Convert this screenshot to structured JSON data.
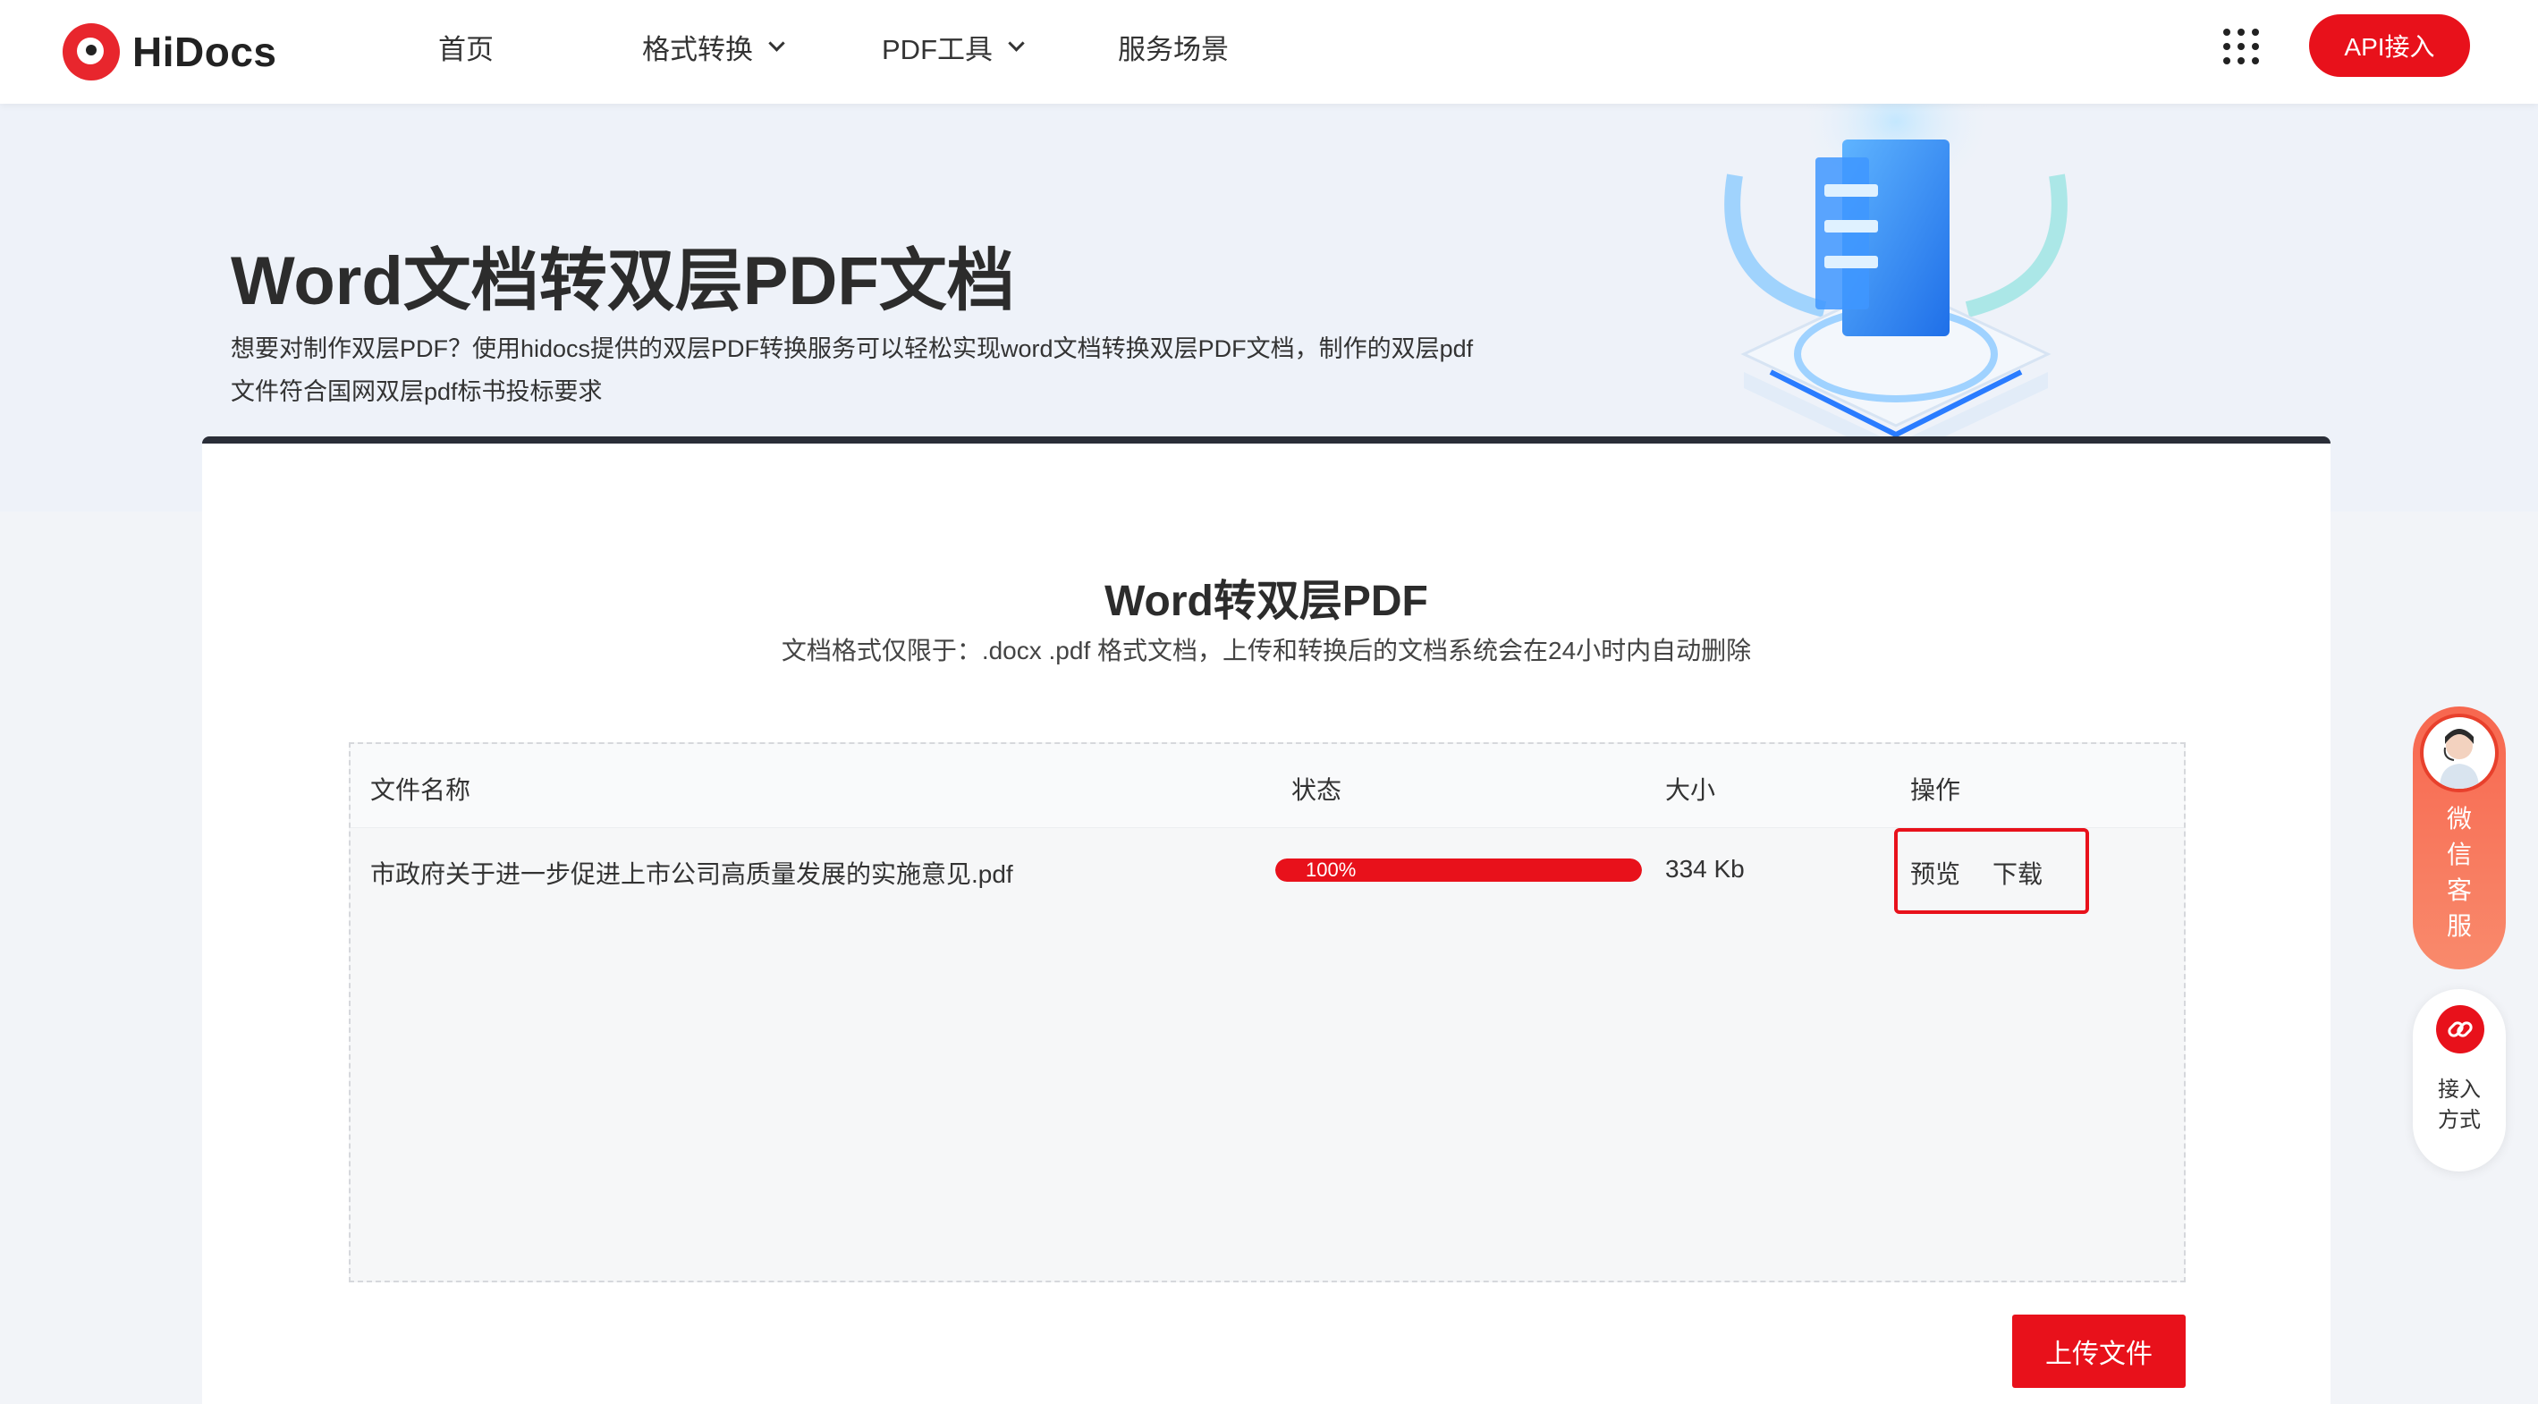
{
  "header": {
    "brand": "HiDocs",
    "nav": [
      {
        "label": "首页"
      },
      {
        "label": "格式转换"
      },
      {
        "label": "PDF工具"
      },
      {
        "label": "服务场景"
      }
    ],
    "api_button": "API接入",
    "apps_icon": "apps-grid-icon"
  },
  "hero": {
    "title": "Word文档转双层PDF文档",
    "description": "想要对制作双层PDF？使用hidocs提供的双层PDF转换服务可以轻松实现word文档转换双层PDF文档，制作的双层pdf文件符合国网双层pdf标书投标要求"
  },
  "converter": {
    "title": "Word转双层PDF",
    "subtitle": "文档格式仅限于：.docx .pdf 格式文档，上传和转换后的文档系统会在24小时内自动删除",
    "columns": {
      "name": "文件名称",
      "status": "状态",
      "size": "大小",
      "actions": "操作"
    },
    "rows": [
      {
        "name": "市政府关于进一步促进上市公司高质量发展的实施意见.pdf",
        "progress_label": "100%",
        "progress": 1.0,
        "size": "334 Kb",
        "preview": "预览",
        "download": "下载"
      }
    ],
    "upload_button": "上传文件"
  },
  "float": {
    "wechat": [
      "微",
      "信",
      "客",
      "服"
    ],
    "access": [
      "接入",
      "方式"
    ]
  },
  "colors": {
    "accent": "#e8111b",
    "float_gradient_start": "#f7674f",
    "card_border": "#2a2e38"
  }
}
